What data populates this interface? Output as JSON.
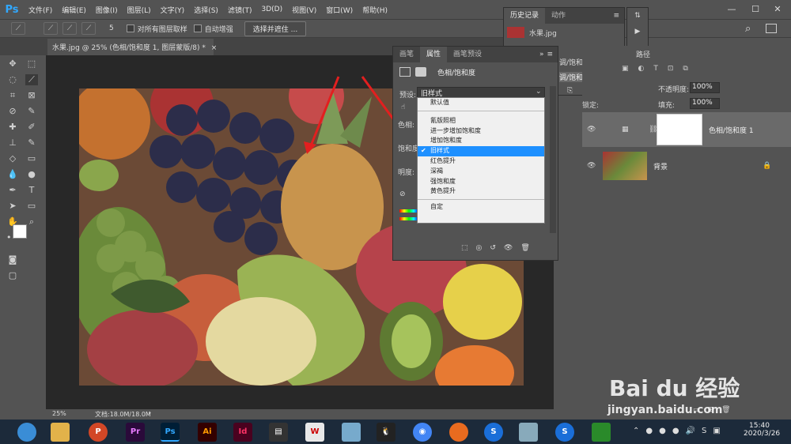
{
  "app": {
    "logo": "Ps"
  },
  "menu": [
    "文件(F)",
    "编辑(E)",
    "图像(I)",
    "图层(L)",
    "文字(Y)",
    "选择(S)",
    "滤镜(T)",
    "3D(D)",
    "视图(V)",
    "窗口(W)",
    "帮助(H)"
  ],
  "options": {
    "brush_size": "5",
    "sample_all_layers": "对所有图层取样",
    "auto_enhance": "自动增强",
    "select_mask_btn": "选择并遮住 ..."
  },
  "document": {
    "tab_title": "水果.jpg @ 25% (色相/饱和度 1, 图层蒙版/8) *",
    "zoom": "25%",
    "doc_info": "文档:18.0M/18.0M"
  },
  "history_panel": {
    "tabs": [
      "历史记录",
      "动作"
    ],
    "snapshot": "水果.jpg",
    "items": [
      "调/饱和度图层",
      "调/饱和度图层"
    ]
  },
  "properties_panel": {
    "tabs": [
      "画笔",
      "属性",
      "画笔预设"
    ],
    "title": "色相/饱和度",
    "preset_label": "预设:",
    "preset_value": "旧样式",
    "master_label": "色相:",
    "saturation_label": "饱和度",
    "lightness_label": "明度:"
  },
  "dropdown": {
    "items": [
      "默认值",
      "氰版照相",
      "进一步增加饱和度",
      "增加饱和度",
      "旧样式",
      "红色提升",
      "深褐",
      "强饱和度",
      "黄色提升",
      "自定"
    ],
    "selected": "旧样式"
  },
  "layers_panel": {
    "path_tab": "路径",
    "opacity_label": "不透明度:",
    "opacity_value": "100%",
    "fill_label": "填充:",
    "fill_value": "100%",
    "lock_label": "锁定:",
    "layers": [
      {
        "name": "色相/饱和度 1"
      },
      {
        "name": "背景"
      }
    ]
  },
  "taskbar": {
    "time": "15:40",
    "date": "2020/3/26",
    "apps": [
      "Pr",
      "Ps",
      "Ai",
      "Id"
    ]
  },
  "watermark": {
    "brand": "Bai du 经验",
    "url": "jingyan.baidu.com"
  }
}
